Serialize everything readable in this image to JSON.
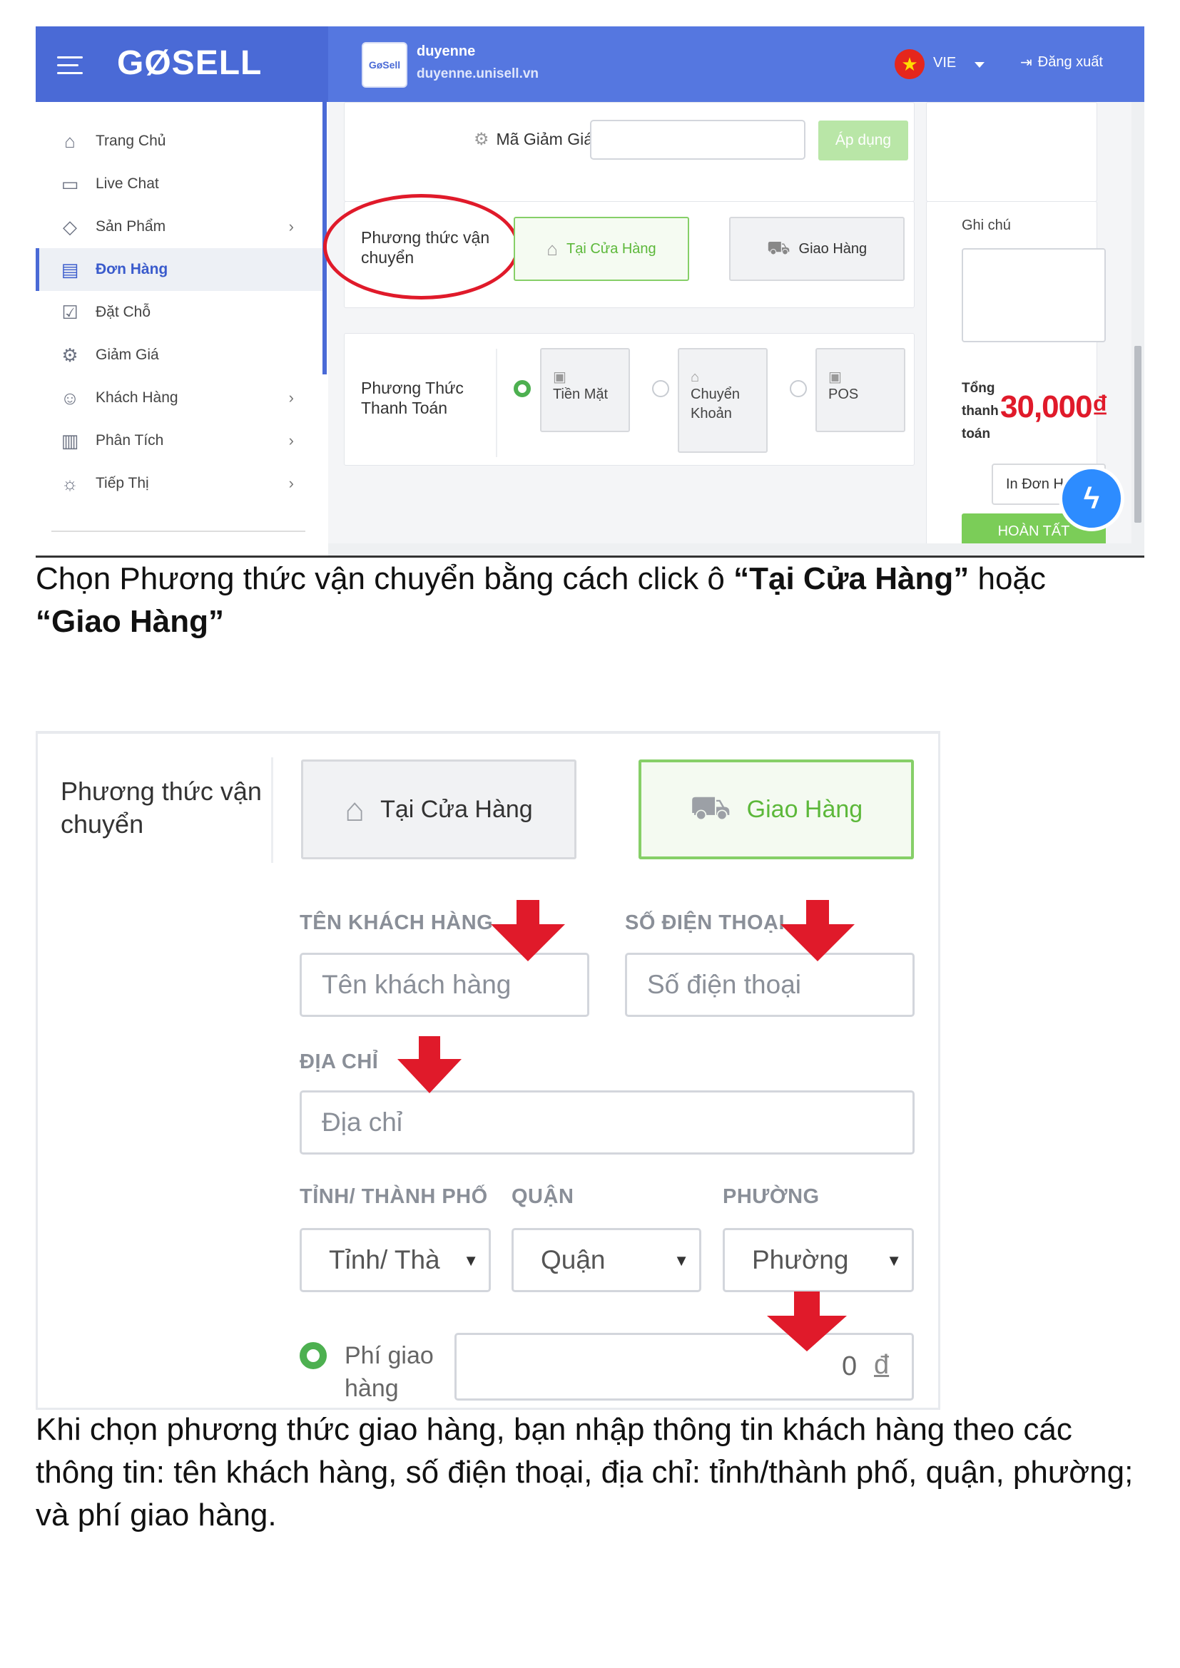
{
  "screenshot1": {
    "header": {
      "logo": "GØSELL",
      "store_avatar_text": "GøSell",
      "store_name": "duyenne",
      "store_url": "duyenne.unisell.vn",
      "language": "VIE",
      "logout_label": "Đăng xuất"
    },
    "sidebar": {
      "items": [
        {
          "label": "Trang Chủ",
          "icon": "home-icon",
          "has_submenu": false
        },
        {
          "label": "Live Chat",
          "icon": "chat-icon",
          "has_submenu": false
        },
        {
          "label": "Sản Phẩm",
          "icon": "tag-icon",
          "has_submenu": true
        },
        {
          "label": "Đơn Hàng",
          "icon": "orders-icon",
          "has_submenu": false,
          "active": true
        },
        {
          "label": "Đặt Chỗ",
          "icon": "calendar-icon",
          "has_submenu": false
        },
        {
          "label": "Giảm Giá",
          "icon": "discount-icon",
          "has_submenu": false
        },
        {
          "label": "Khách Hàng",
          "icon": "customers-icon",
          "has_submenu": true
        },
        {
          "label": "Phân Tích",
          "icon": "analytics-icon",
          "has_submenu": true
        },
        {
          "label": "Tiếp Thị",
          "icon": "lightbulb-icon",
          "has_submenu": true
        }
      ]
    },
    "coupon": {
      "label": "Mã Giảm Giá",
      "input_value": "",
      "apply_label": "Áp dụng"
    },
    "shipping": {
      "label": "Phương thức vận chuyển",
      "options": [
        {
          "label": "Tại Cửa Hàng",
          "icon": "store-icon",
          "selected": true
        },
        {
          "label": "Giao Hàng",
          "icon": "truck-icon",
          "selected": false
        }
      ]
    },
    "payment": {
      "label": "Phương Thức Thanh Toán",
      "options": [
        {
          "label": "Tiền Mặt",
          "icon": "cash-icon",
          "selected": true
        },
        {
          "label": "Chuyển Khoản",
          "icon": "bank-icon",
          "selected": false
        },
        {
          "label": "POS",
          "icon": "pos-icon",
          "selected": false
        }
      ]
    },
    "order_summary": {
      "note_label": "Ghi chú",
      "total_label": "Tổng thanh toán",
      "total_value": "30,000₫",
      "print_label": "In Đơn H",
      "done_label": "HOÀN TẤT"
    },
    "colors": {
      "brand_blue": "#4a6ad6",
      "selected_green": "#5cb83a",
      "highlight_red": "#e01a2a"
    }
  },
  "caption1": {
    "prefix": "Chọn Phương thức vận chuyển bằng cách click ô ",
    "bold1": "“Tại Cửa Hàng”",
    "middle": " hoặc ",
    "bold2": "“Giao Hàng”"
  },
  "screenshot2": {
    "shipping_label": "Phương thức vận chuyển",
    "options": [
      {
        "label": "Tại Cửa Hàng",
        "icon": "store-icon",
        "selected": false
      },
      {
        "label": "Giao Hàng",
        "icon": "truck-icon",
        "selected": true
      }
    ],
    "fields": {
      "customer_name": {
        "label": "TÊN KHÁCH HÀNG",
        "placeholder": "Tên khách hàng",
        "value": ""
      },
      "phone": {
        "label": "SỐ ĐIỆN THOẠI",
        "placeholder": "Số điện thoại",
        "value": ""
      },
      "address": {
        "label": "ĐỊA CHỈ",
        "placeholder": "Địa chỉ",
        "value": ""
      },
      "province": {
        "label": "TỈNH/ THÀNH PHỐ",
        "selected": "Tỉnh/ Thà"
      },
      "district": {
        "label": "QUẬN",
        "selected": "Quận"
      },
      "ward": {
        "label": "PHƯỜNG",
        "selected": "Phường"
      }
    },
    "shipping_fee": {
      "label": "Phí giao hàng",
      "value": "0",
      "currency": "đ"
    }
  },
  "caption2": {
    "text": "Khi chọn phương thức giao hàng, bạn nhập thông tin khách hàng theo các thông tin: tên khách hàng, số điện thoại, địa chỉ: tỉnh/thành phố, quận, phường; và phí giao hàng."
  }
}
